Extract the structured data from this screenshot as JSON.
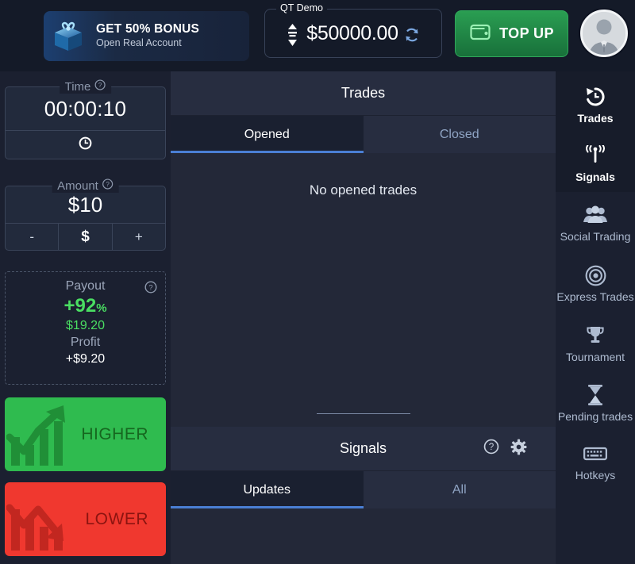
{
  "topbar": {
    "bonus": {
      "title": "GET 50% BONUS",
      "subtitle": "Open Real Account",
      "icon": "gift-box-icon"
    },
    "balance": {
      "account_label": "QT Demo",
      "amount": "$50000.00",
      "refresh_icon": "refresh-icon",
      "selector_icon": "up-down-arrows-icon"
    },
    "topup": {
      "label": "TOP UP",
      "icon": "wallet-icon"
    },
    "avatar": {
      "icon": "user-avatar-icon"
    }
  },
  "left_panel": {
    "time": {
      "legend": "Time",
      "help_icon": "question-mark-icon",
      "value": "00:00:10",
      "mode_icon": "clock-icon"
    },
    "amount": {
      "legend": "Amount",
      "help_icon": "question-mark-icon",
      "value": "$10",
      "minus_label": "-",
      "currency_label": "$",
      "plus_label": "+"
    },
    "payout": {
      "title": "Payout",
      "help_icon": "question-mark-icon",
      "percent": "+92",
      "percent_unit": "%",
      "amount": "$19.20",
      "profit_label": "Profit",
      "profit_value": "+$9.20"
    },
    "higher_button": {
      "label": "HIGHER",
      "icon": "uptrend-arrow-icon"
    },
    "lower_button": {
      "label": "LOWER",
      "icon": "downtrend-arrow-icon"
    }
  },
  "trades_panel": {
    "title": "Trades",
    "tabs": [
      {
        "label": "Opened",
        "active": true
      },
      {
        "label": "Closed",
        "active": false
      }
    ],
    "empty_message": "No opened trades"
  },
  "signals_panel": {
    "title": "Signals",
    "help_icon": "question-mark-icon",
    "settings_icon": "gear-icon",
    "tabs": [
      {
        "label": "Updates",
        "active": true
      },
      {
        "label": "All",
        "active": false
      }
    ]
  },
  "right_rail": {
    "items": [
      {
        "label": "Trades",
        "icon": "history-clock-icon",
        "active": true
      },
      {
        "label": "Signals",
        "icon": "antenna-icon",
        "active": true
      },
      {
        "label": "Social Trading",
        "icon": "people-group-icon",
        "active": false
      },
      {
        "label": "Express Trades",
        "icon": "target-icon",
        "active": false
      },
      {
        "label": "Tournament",
        "icon": "trophy-icon",
        "active": false
      },
      {
        "label": "Pending trades",
        "icon": "hourglass-icon",
        "active": false
      },
      {
        "label": "Hotkeys",
        "icon": "keyboard-icon",
        "active": false
      }
    ]
  },
  "colors": {
    "topbar_bg": "#141a28",
    "panel_bg": "#232838",
    "sidebar_bg": "#1b2030",
    "header_bg": "#272d40",
    "accent_blue": "#4a7fd4",
    "green": "#2fbb4f",
    "red": "#f0382f",
    "payout_green": "#4ade62",
    "topup_green": "#2a9e52"
  }
}
